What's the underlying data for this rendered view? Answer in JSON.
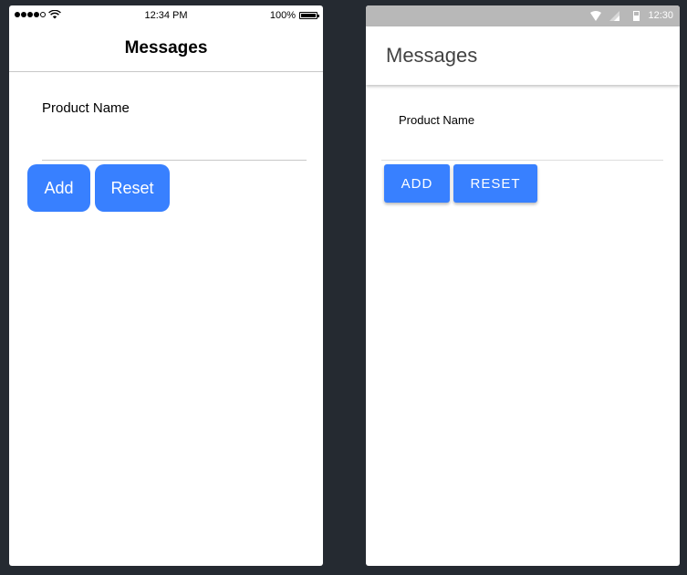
{
  "ios": {
    "status": {
      "time": "12:34 PM",
      "battery": "100%"
    },
    "title": "Messages",
    "product_label": "Product Name",
    "product_value": "",
    "add_label": "Add",
    "reset_label": "Reset"
  },
  "android": {
    "status": {
      "time": "12:30"
    },
    "title": "Messages",
    "product_label": "Product Name",
    "product_value": "",
    "add_label": "Add",
    "reset_label": "Reset"
  },
  "colors": {
    "primary": "#3880ff",
    "background": "#252a31",
    "android_status_bar": "#b8b8b8"
  },
  "icons": [
    "signal-dots-icon",
    "wifi-icon",
    "battery-icon",
    "cell-signal-icon"
  ]
}
